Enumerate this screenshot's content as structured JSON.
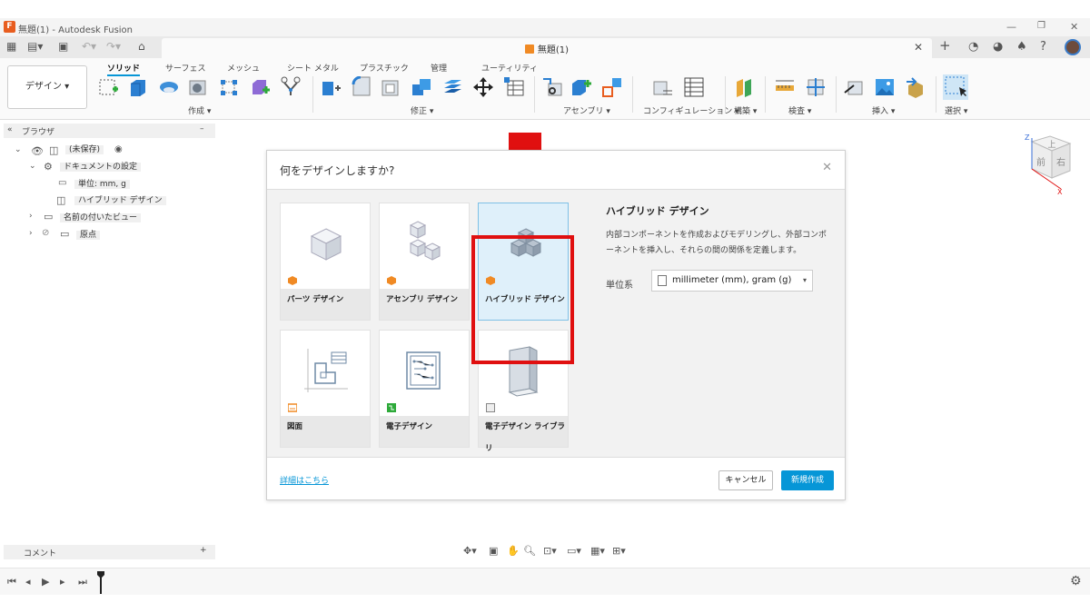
{
  "window": {
    "title": "無題(1) - Autodesk Fusion",
    "logo_letter": "F",
    "controls": [
      "—",
      "❐",
      "✕"
    ]
  },
  "tabbar": {
    "doc_tab_title": "無題(1)",
    "close_symbol": "✕"
  },
  "ribbon": {
    "workspace_button": "デザイン ▾",
    "tabs": [
      "ソリッド",
      "サーフェス",
      "メッシュ",
      "シート メタル",
      "プラスチック",
      "管理",
      "ユーティリティ"
    ],
    "groups": [
      "作成 ▾",
      "修正 ▾",
      "アセンブリ ▾",
      "コンフィギュレーション ▾",
      "構築 ▾",
      "検査 ▾",
      "挿入 ▾",
      "選択 ▾"
    ]
  },
  "browser": {
    "header": "ブラウザ",
    "collapse": "«",
    "minus": "–",
    "items": [
      {
        "label": "(未保存)"
      },
      {
        "label": "ドキュメントの設定"
      },
      {
        "label": "単位: mm, g"
      },
      {
        "label": "ハイブリッド デザイン"
      },
      {
        "label": "名前の付いたビュー"
      },
      {
        "label": "原点"
      }
    ]
  },
  "dialog": {
    "title": "何をデザインしますか?",
    "close": "✕",
    "cards": [
      {
        "label": "パーツ デザイン"
      },
      {
        "label": "アセンブリ デザイン"
      },
      {
        "label": "ハイブリッド デザイン"
      },
      {
        "label": "図面"
      },
      {
        "label": "電子デザイン"
      },
      {
        "label": "電子デザイン ライブラリ"
      }
    ],
    "selected_title": "ハイブリッド デザイン",
    "description": "内部コンポーネントを作成およびモデリングし、外部コンポーネントを挿入し、それらの間の関係を定義します。",
    "unit_label": "単位系",
    "unit_value": "millimeter (mm), gram (g)",
    "unit_dropdown": "▾",
    "more_link": "詳細はこちら",
    "cancel": "キャンセル",
    "create": "新規作成"
  },
  "viewcube": {
    "top": "上",
    "front": "前",
    "right": "右",
    "x": "X",
    "z": "Z"
  },
  "comments": {
    "label": "コメント",
    "add": "+"
  },
  "colors": {
    "accent": "#0696d7",
    "highlight": "#e01010",
    "selected_bg": "#dff0fa"
  }
}
